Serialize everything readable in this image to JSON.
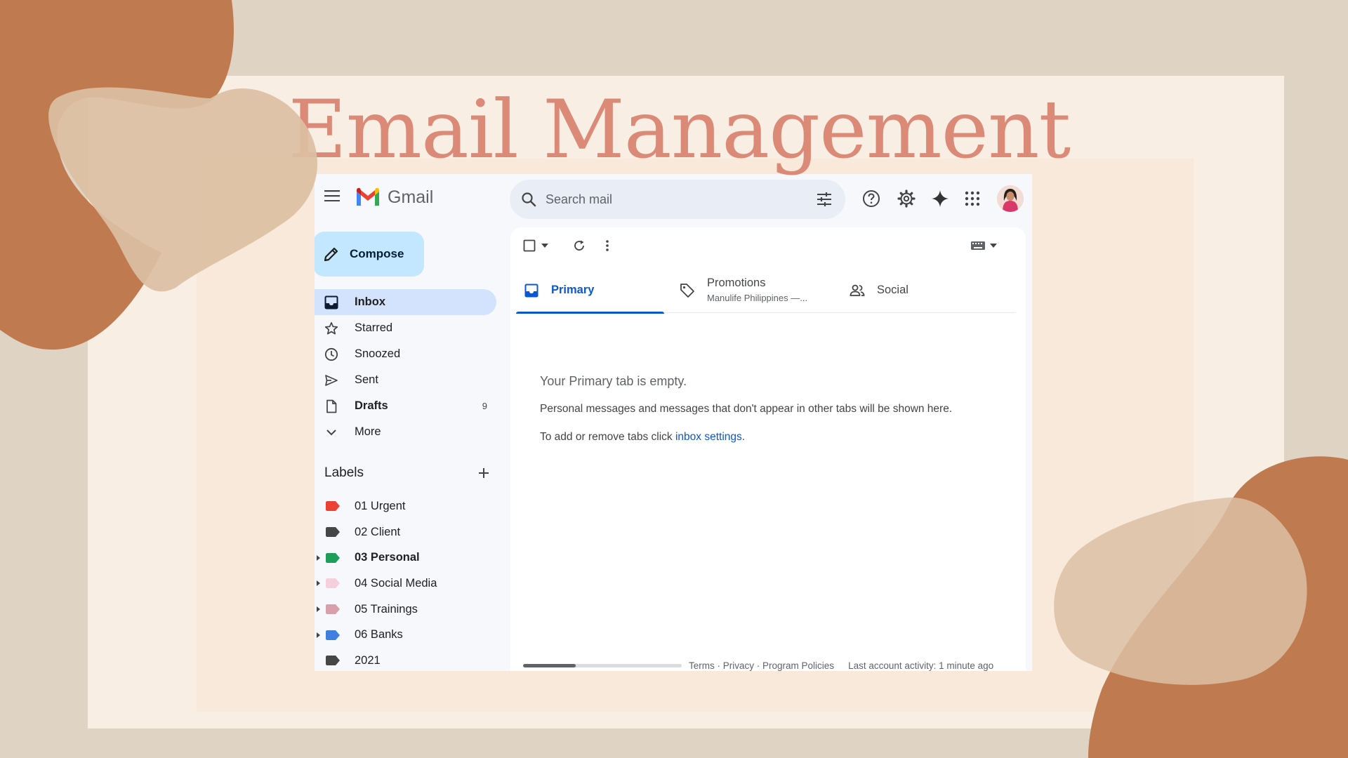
{
  "slide": {
    "title": "Email Management"
  },
  "colors": {
    "accent": "#0b57d0",
    "compose": "#c2e7ff",
    "inbox_active": "#d3e3fd",
    "bg_tan": "#dfd3c3",
    "blob_rust": "#c07a50",
    "blob_beige": "#dcbfa3"
  },
  "header": {
    "app_name": "Gmail",
    "search_placeholder": "Search mail",
    "icons": [
      "menu-icon",
      "search-icon",
      "tune-icon",
      "help-icon",
      "gear-icon",
      "gemini-sparkle-icon",
      "apps-grid-icon",
      "avatar"
    ]
  },
  "sidebar": {
    "compose_label": "Compose",
    "items": [
      {
        "label": "Inbox",
        "icon": "inbox-icon",
        "active": true,
        "bold": true,
        "count": ""
      },
      {
        "label": "Starred",
        "icon": "star-icon",
        "count": ""
      },
      {
        "label": "Snoozed",
        "icon": "clock-icon",
        "count": ""
      },
      {
        "label": "Sent",
        "icon": "send-icon",
        "count": ""
      },
      {
        "label": "Drafts",
        "icon": "file-icon",
        "bold": true,
        "count": "9"
      },
      {
        "label": "More",
        "icon": "chevron-down-icon",
        "count": ""
      }
    ],
    "labels_title": "Labels",
    "labels": [
      {
        "name": "01 Urgent",
        "color": "#ea4335",
        "expandable": false,
        "bold": false
      },
      {
        "name": "02 Client",
        "color": "#444746",
        "expandable": false,
        "bold": false
      },
      {
        "name": "03 Personal",
        "color": "#1e9e5a",
        "expandable": true,
        "bold": true
      },
      {
        "name": "04 Social Media",
        "color": "#f6cfdc",
        "expandable": true,
        "bold": false
      },
      {
        "name": "05 Trainings",
        "color": "#d8a0aa",
        "expandable": true,
        "bold": false
      },
      {
        "name": "06 Banks",
        "color": "#3f7fe0",
        "expandable": true,
        "bold": false
      },
      {
        "name": "2021",
        "color": "#444746",
        "expandable": false,
        "bold": false
      }
    ]
  },
  "main": {
    "tabs": [
      {
        "label": "Primary",
        "icon": "inbox-tab-icon",
        "active": true,
        "subtitle": ""
      },
      {
        "label": "Promotions",
        "icon": "tag-icon",
        "active": false,
        "subtitle": "Manulife Philippines —..."
      },
      {
        "label": "Social",
        "icon": "people-icon",
        "active": false,
        "subtitle": ""
      }
    ],
    "empty_title": "Your Primary tab is empty.",
    "empty_text": "Personal messages and messages that don't appear in other tabs will be shown here.",
    "empty_text2_prefix": "To add or remove tabs click ",
    "empty_text2_link": "inbox settings",
    "empty_text2_suffix": "."
  },
  "footer": {
    "storage_used_fraction": 0.33,
    "terms": "Terms",
    "privacy": "Privacy",
    "program_policies": "Program Policies",
    "separator": " · ",
    "last_activity": "Last account activity: 1 minute ago"
  }
}
